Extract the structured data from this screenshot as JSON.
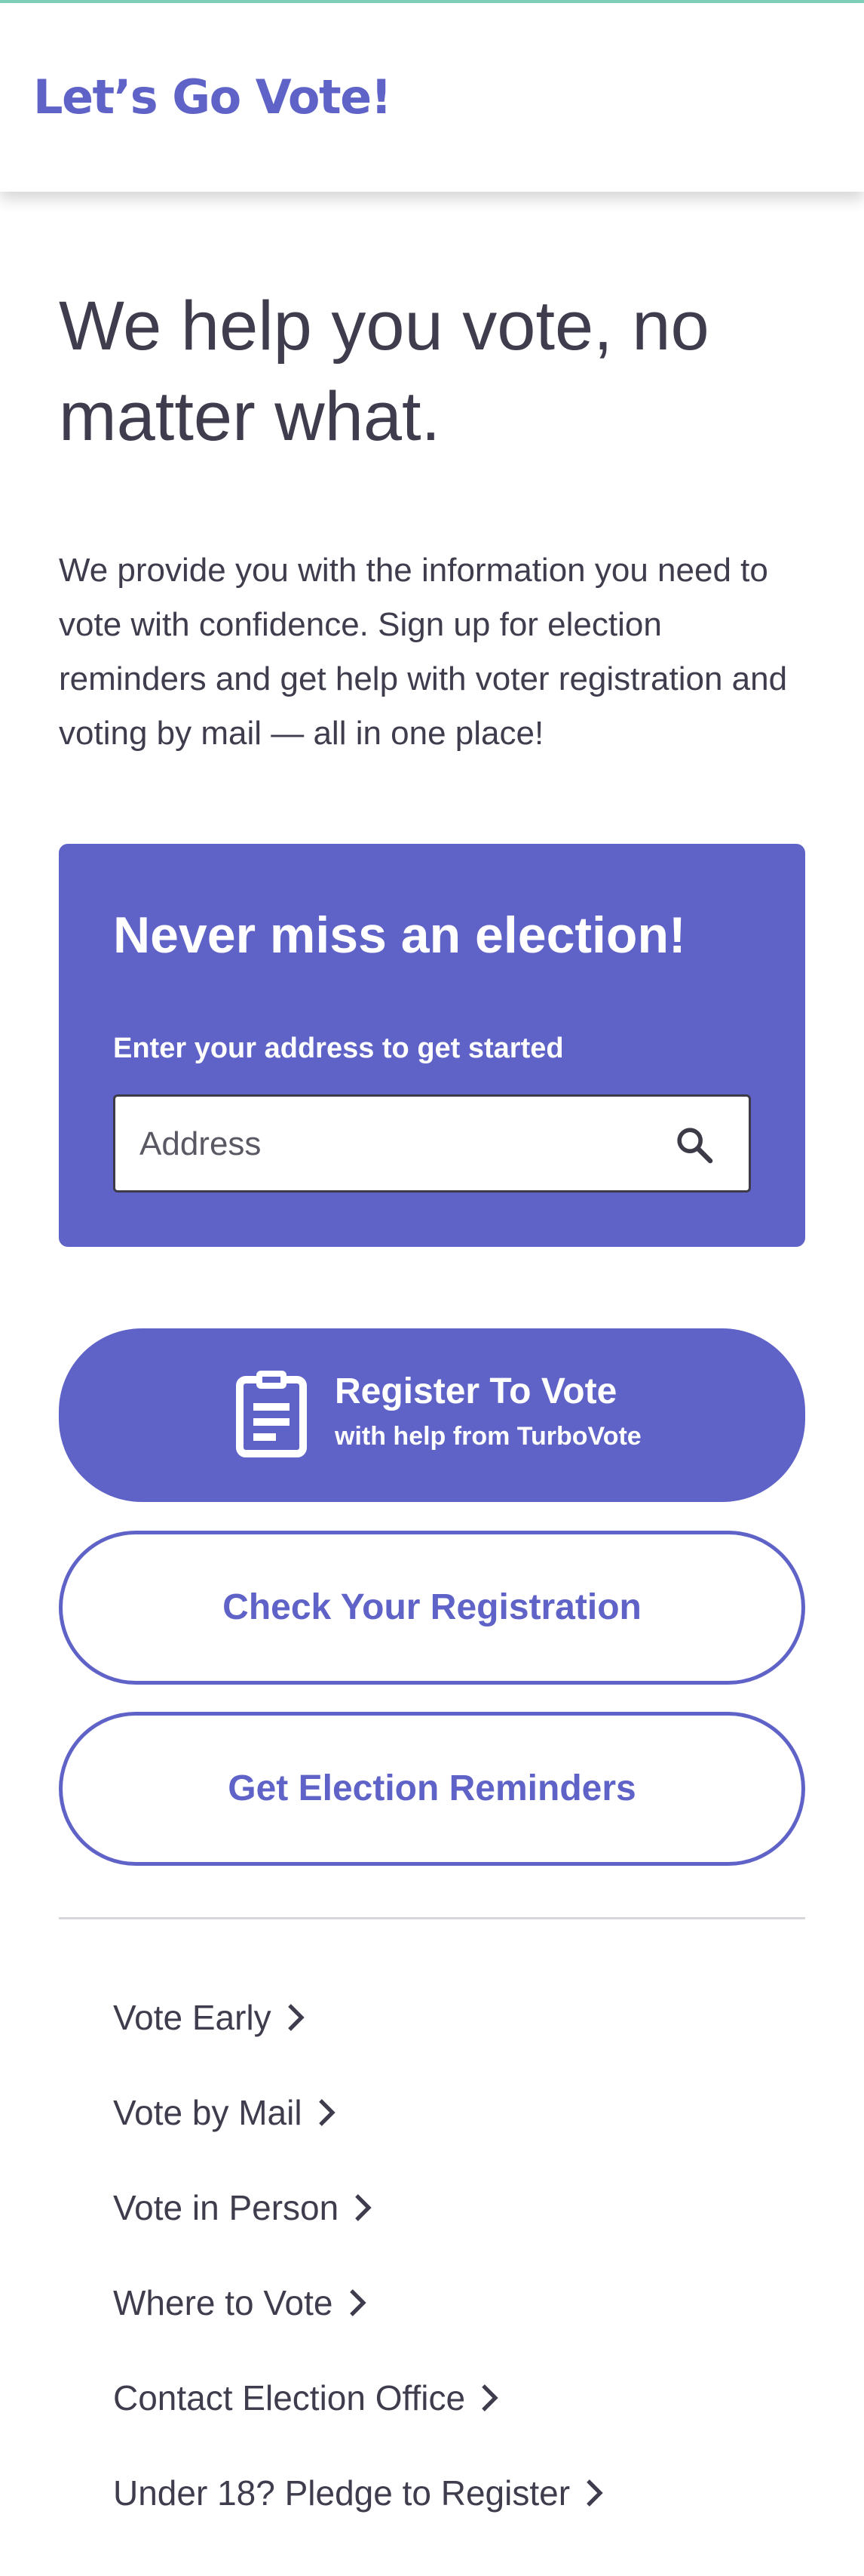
{
  "header": {
    "logo_text": "Let’s Go Vote!"
  },
  "hero": {
    "title": "We help you vote, no matter what.",
    "body": "We provide you with the information you need to vote with confidence. Sign up for election reminders and get help with voter registration and voting by mail — all in one place!"
  },
  "signup_card": {
    "title": "Never miss an election!",
    "label": "Enter your address to get started",
    "placeholder": "Address",
    "icon": "search-icon"
  },
  "actions": {
    "register_title": "Register To Vote",
    "register_subtitle": "with help from TurboVote",
    "register_icon": "clipboard-icon",
    "check_registration": "Check Your Registration",
    "election_reminders": "Get Election Reminders"
  },
  "links": [
    {
      "label": "Vote Early"
    },
    {
      "label": "Vote by Mail"
    },
    {
      "label": "Vote in Person"
    },
    {
      "label": "Where to Vote"
    },
    {
      "label": "Contact Election Office"
    },
    {
      "label": "Under 18? Pledge to Register"
    }
  ],
  "colors": {
    "brand": "#5f63c7",
    "text": "#3f3d4d",
    "top_accent": "#7fd1b9",
    "divider": "#d7d7dc"
  }
}
